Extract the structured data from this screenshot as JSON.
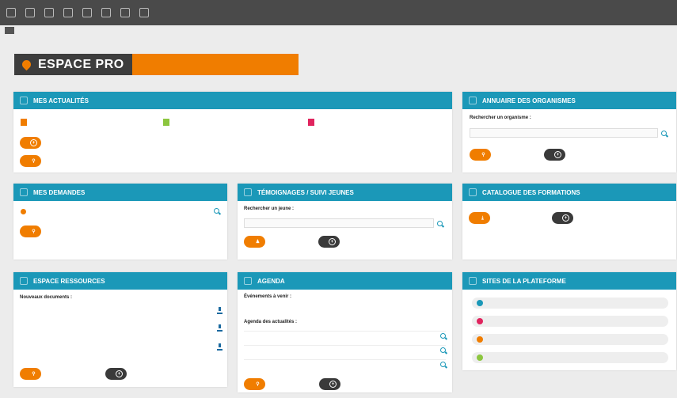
{
  "nav": {
    "items": [
      {
        "label": "",
        "icon": "grid-icon"
      },
      {
        "label": "",
        "icon": "book-icon"
      },
      {
        "label": "",
        "icon": "folder-icon"
      },
      {
        "label": "",
        "icon": "people-icon"
      },
      {
        "label": "",
        "icon": "book-open-icon"
      },
      {
        "label": "",
        "icon": "document-icon"
      },
      {
        "label": "",
        "icon": "calendar-icon"
      },
      {
        "label": "",
        "icon": "user-icon"
      }
    ]
  },
  "breadcrumb": "",
  "hero": {
    "logo": "ESPACE PRO",
    "message_line1": "",
    "message_line2": ""
  },
  "actualites": {
    "title": "MES ACTUALITÉS",
    "tags": [
      "",
      "",
      ""
    ],
    "btn_add": "",
    "btn_all": ""
  },
  "annuaire": {
    "title": "ANNUAIRE DES ORGANISMES",
    "search_label": "Rechercher un organisme :",
    "search_placeholder": "",
    "btn_list": "",
    "btn_update": ""
  },
  "demandes": {
    "title": "MES DEMANDES",
    "item": "",
    "btn_all": ""
  },
  "temoignages": {
    "title": "TÉMOIGNAGES / SUIVI JEUNES",
    "search_label": "Rechercher un jeune :",
    "search_placeholder": "",
    "btn_depot": "",
    "btn_create": ""
  },
  "catalogue": {
    "title": "CATALOGUE DES FORMATIONS",
    "btn_download": "",
    "btn_propose": ""
  },
  "ressources": {
    "title": "ESPACE RESSOURCES",
    "heading": "Nouveaux documents :",
    "docs": [
      "",
      "",
      ""
    ],
    "btn_all": "",
    "btn_add": ""
  },
  "agenda": {
    "title": "AGENDA",
    "upcoming_label": "Événements à venir :",
    "upcoming_text": "",
    "news_label": "Agenda des actualités :",
    "news": [
      "",
      "",
      ""
    ],
    "btn_access": "",
    "btn_add": ""
  },
  "sites": {
    "title": "SITES DE LA PLATEFORME",
    "items": [
      "",
      "",
      "",
      ""
    ]
  },
  "colors": {
    "header_blue": "#1b98b8",
    "accent_orange": "#f07d00",
    "dark": "#3a3a3a",
    "tag_orange": "#f07d00",
    "tag_green": "#8cc63f",
    "tag_red": "#e0245e"
  }
}
